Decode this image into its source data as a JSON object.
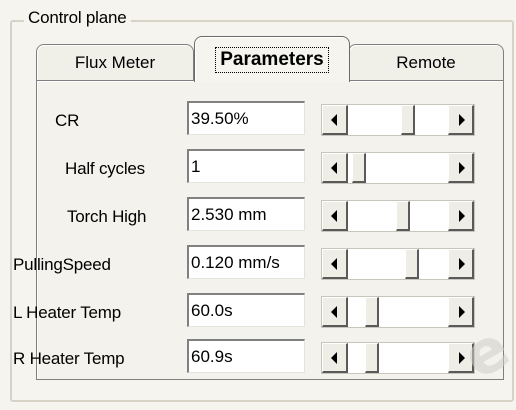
{
  "group": {
    "title": "Control plane"
  },
  "tabs": [
    {
      "label": "Flux Meter"
    },
    {
      "label": "Parameters"
    },
    {
      "label": "Remote"
    }
  ],
  "active_tab": "Parameters",
  "parameters": [
    {
      "label": "CR",
      "value": "39.50%",
      "slider_position": 0.62
    },
    {
      "label": "Half cycles",
      "value": "1",
      "slider_position": 0.05
    },
    {
      "label": "Torch High",
      "value": "2.530 mm",
      "slider_position": 0.56
    },
    {
      "label": "PullingSpeed",
      "value": "0.120 mm/s",
      "slider_position": 0.66
    },
    {
      "label": "L Heater Temp",
      "value": "60.0s",
      "slider_position": 0.2
    },
    {
      "label": "R Heater Temp",
      "value": "60.9s",
      "slider_position": 0.2
    }
  ],
  "icons": {
    "scroll_left": "arrow-left-icon",
    "scroll_right": "arrow-right-icon"
  },
  "colors": {
    "background": "#f5f4ee",
    "textbox": "#ffffff",
    "border": "#7f7f7f"
  }
}
